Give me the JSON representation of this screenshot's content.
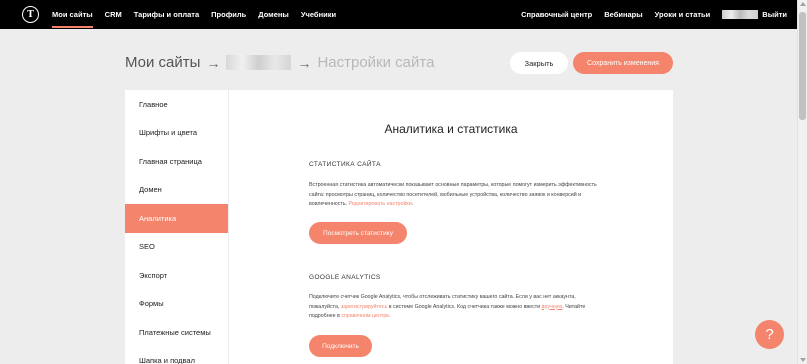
{
  "topnav": {
    "logo": "T",
    "left": [
      "Мои сайты",
      "CRM",
      "Тарифы и оплата",
      "Профиль",
      "Домены",
      "Учебники"
    ],
    "right": [
      "Справочный центр",
      "Вебинары",
      "Уроки и статьи"
    ],
    "logout": "Выйти"
  },
  "breadcrumb": {
    "root": "Мои сайты",
    "arrow": "→",
    "current": "Настройки сайта"
  },
  "buttons": {
    "close": "Закрыть",
    "save": "Сохранить изменения"
  },
  "sidebar": {
    "items": [
      "Главное",
      "Шрифты и цвета",
      "Главная страница",
      "Домен",
      "Аналитика",
      "SEO",
      "Экспорт",
      "Формы",
      "Платежные системы",
      "Шапка и подвал"
    ],
    "active_index": 4
  },
  "main": {
    "title": "Аналитика и статистика",
    "stats": {
      "title": "СТАТИСТИКА САЙТА",
      "text": "Встроенная статистика автоматически показывает основные параметры, которые помогут измерить эффективность сайта: просмотры страниц, количество посетителей, мобильные устройства, количество заявок и конверсий и вовлеченность.",
      "link": "Редактировать настройки",
      "button": "Посмотреть статистику"
    },
    "ga": {
      "title": "GOOGLE ANALYTICS",
      "text1": "Подключите счетчик Google Analytics, чтобы отслеживать статистику вашего сайта. Если у вас нет аккаунта, пожалуйста,",
      "link1": "зарегистрируйтесь",
      "text2": "в системе Google Analytics. Код счетчика также можно ввести",
      "link2": "вручную",
      "text3": ". Читайте подробнее в",
      "link3": "справочном центре",
      "button": "Подключить"
    }
  },
  "help": {
    "label": "?"
  },
  "colors": {
    "accent": "#f4846b",
    "topbar": "#000000",
    "background": "#ededed"
  }
}
